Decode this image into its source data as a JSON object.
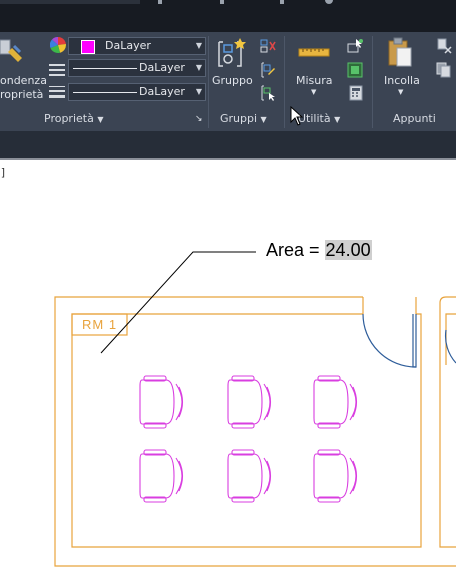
{
  "ribbon": {
    "properties_panel": {
      "title": "Proprietà",
      "match_label_line1": "ondenza",
      "match_label_line2": "roprietà",
      "color_value": "DaLayer",
      "linetype_value": "DaLayer",
      "lineweight_value": "DaLayer"
    },
    "groups_panel": {
      "title": "Gruppi",
      "group_button_label": "Gruppo"
    },
    "utilities_panel": {
      "title": "Utilità",
      "measure_button_label": "Misura"
    },
    "clipboard_panel": {
      "title": "Appunti",
      "paste_button_label": "Incolla"
    }
  },
  "viewport": {
    "corner_text": "]"
  },
  "drawing": {
    "area_label": "Area = ",
    "area_value": "24.00",
    "room_tag": "RM 1"
  },
  "colors": {
    "ribbon_bg": "#3b4453",
    "wall_orange": "#e8a33c",
    "chair_magenta": "#d93ee0",
    "door_blue": "#2e5d9a",
    "bylayer_swatch": "#ff00ff"
  }
}
